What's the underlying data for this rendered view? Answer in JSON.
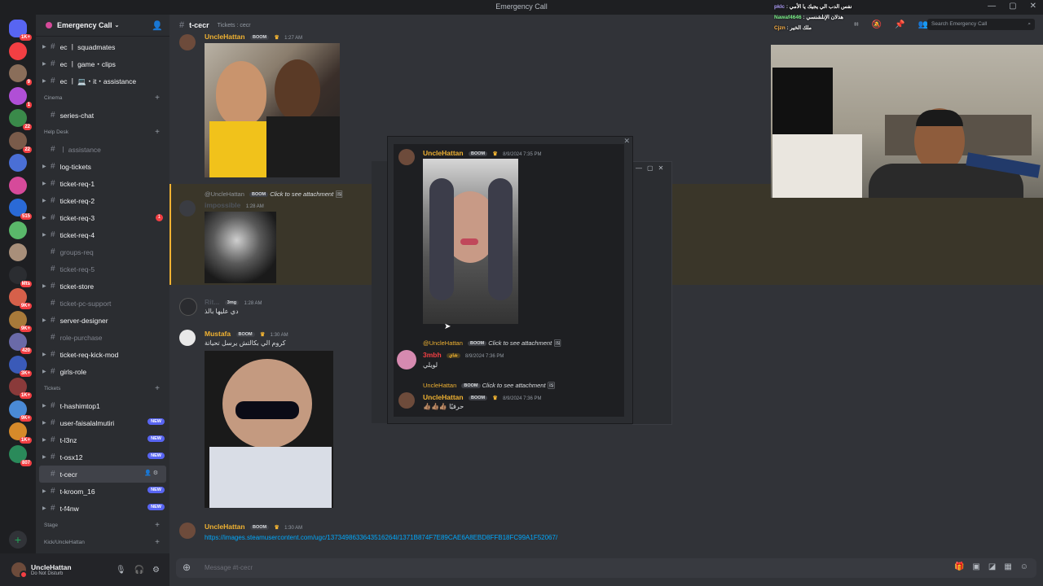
{
  "window": {
    "title": "Emergency Call"
  },
  "server": {
    "name": "Emergency Call"
  },
  "servers": [
    {
      "badge": "1K+",
      "color": "#5865f2"
    },
    {
      "badge": "",
      "color": "#f23f43"
    },
    {
      "badge": "9",
      "color": "#8a6e5a"
    },
    {
      "badge": "1",
      "color": "#b04fd6"
    },
    {
      "badge": "22",
      "color": "#3a8a4a"
    },
    {
      "badge": "22",
      "color": "#7a5b4a"
    },
    {
      "badge": "",
      "color": "#4a6fd6"
    },
    {
      "badge": "",
      "color": "#d64a9a"
    },
    {
      "badge": "515",
      "color": "#2a6ad6"
    },
    {
      "badge": "",
      "color": "#5ab86a"
    },
    {
      "badge": "",
      "color": "#a88f7a"
    },
    {
      "badge": "Mts",
      "color": "#2b2d31"
    },
    {
      "badge": "9K+",
      "color": "#d6604a"
    },
    {
      "badge": "9K+",
      "color": "#a87a3a"
    },
    {
      "badge": "420",
      "color": "#6a6aa8"
    },
    {
      "badge": "3K+",
      "color": "#3a5ab8"
    },
    {
      "badge": "1K+",
      "color": "#8a3a3a"
    },
    {
      "badge": "9K+",
      "color": "#4a8ad6"
    },
    {
      "badge": "1K+",
      "color": "#d68a2a"
    },
    {
      "badge": "807",
      "color": "#2a8a5a"
    }
  ],
  "channels": [
    {
      "kind": "channel",
      "name": "ec ㅣ squadmates",
      "state": "normal",
      "caret": true
    },
    {
      "kind": "channel",
      "name": "ec ㅣ game・clips",
      "state": "normal",
      "caret": true
    },
    {
      "kind": "channel",
      "name": "ec ㅣ 💻・it・assistance",
      "state": "normal",
      "caret": true
    },
    {
      "kind": "category",
      "name": "Cinema"
    },
    {
      "kind": "channel",
      "name": "series-chat",
      "state": "normal",
      "caret": false
    },
    {
      "kind": "category",
      "name": "Help Desk"
    },
    {
      "kind": "channel",
      "name": "ㅣ assistance",
      "state": "muted",
      "caret": false
    },
    {
      "kind": "channel",
      "name": "log-tickets",
      "state": "normal",
      "caret": true
    },
    {
      "kind": "channel",
      "name": "ticket-req-1",
      "state": "normal",
      "caret": true
    },
    {
      "kind": "channel",
      "name": "ticket-req-2",
      "state": "normal",
      "caret": true
    },
    {
      "kind": "channel",
      "name": "ticket-req-3",
      "state": "normal",
      "caret": true,
      "count": "1"
    },
    {
      "kind": "channel",
      "name": "ticket-req-4",
      "state": "normal",
      "caret": true
    },
    {
      "kind": "channel",
      "name": "groups-req",
      "state": "muted",
      "caret": false
    },
    {
      "kind": "channel",
      "name": "ticket-req-5",
      "state": "muted",
      "caret": false
    },
    {
      "kind": "channel",
      "name": "ticket-store",
      "state": "normal",
      "caret": true
    },
    {
      "kind": "channel",
      "name": "ticket-pc-support",
      "state": "muted",
      "caret": false
    },
    {
      "kind": "channel",
      "name": "server-designer",
      "state": "normal",
      "caret": true
    },
    {
      "kind": "channel",
      "name": "role-purchase",
      "state": "muted",
      "caret": false
    },
    {
      "kind": "channel",
      "name": "ticket-req-kick-mod",
      "state": "normal",
      "caret": true
    },
    {
      "kind": "channel",
      "name": "girls-role",
      "state": "normal",
      "caret": true
    },
    {
      "kind": "category",
      "name": "Tickets"
    },
    {
      "kind": "channel",
      "name": "t-hashimtop1",
      "state": "normal",
      "caret": true
    },
    {
      "kind": "channel",
      "name": "user-faisalalmutiri",
      "state": "normal",
      "caret": true,
      "new": "NEW"
    },
    {
      "kind": "channel",
      "name": "t-l3nz",
      "state": "normal",
      "caret": true,
      "new": "NEW"
    },
    {
      "kind": "channel",
      "name": "t-osx12",
      "state": "normal",
      "caret": true,
      "new": "NEW"
    },
    {
      "kind": "channel",
      "name": "t-cecr",
      "state": "active",
      "caret": false
    },
    {
      "kind": "channel",
      "name": "t-kroom_16",
      "state": "normal",
      "caret": true,
      "new": "NEW"
    },
    {
      "kind": "channel",
      "name": "t-f4nw",
      "state": "normal",
      "caret": true,
      "new": "NEW"
    },
    {
      "kind": "category",
      "name": "Stage"
    },
    {
      "kind": "category",
      "name": "Kick/UncleHattan"
    }
  ],
  "user": {
    "name": "UncleHattan",
    "status": "Do Not Disturb"
  },
  "chat_header": {
    "channel": "t-cecr",
    "topic": "Tickets : cecr",
    "search_placeholder": "Search Emergency Call"
  },
  "messages": {
    "m1": {
      "author": "UncleHattan",
      "tag": "BOOM",
      "time": "1:27 AM"
    },
    "m2": {
      "reply_author": "@UncleHattan",
      "reply_tag": "BOOM",
      "reply_cta": "Click to see attachment",
      "author": "impossible",
      "time": "1:28 AM"
    },
    "m3": {
      "author": "Rit...",
      "tag": "3mg",
      "time": "1:28 AM",
      "text": "دي عليها بالذ"
    },
    "m4": {
      "author": "Mustafa",
      "tag": "BOOM",
      "time": "1:30 AM",
      "text": "كروم الي بكالتش يرسل تحياتة"
    },
    "m5": {
      "author": "UncleHattan",
      "tag": "BOOM",
      "time": "1:30 AM",
      "link": "https://images.steamusercontent.com/ugc/1373498633643516264l/1371B874F7E89CAE6A8EBD8FFB18FC99A1F52067/"
    }
  },
  "popup": {
    "p1": {
      "author": "UncleHattan",
      "tag": "BOOM",
      "time": "8/9/2024 7:35 PM"
    },
    "p2": {
      "reply_author": "@UncleHattan",
      "reply_tag": "BOOM",
      "reply_cta": "Click to see attachment",
      "author": "3mbh",
      "tag": "شاي",
      "time": "8/9/2024 7:36 PM",
      "text": "لويلي"
    },
    "p3": {
      "reply_author": "UncleHattan",
      "reply_tag": "BOOM",
      "reply_cta": "Click to see attachment",
      "author": "UncleHattan",
      "tag": "BOOM",
      "time": "8/9/2024 7:36 PM",
      "text": "👍🏽👍🏽👍🏽 حرفيًا"
    }
  },
  "composer": {
    "placeholder": "Message #t-cecr"
  },
  "overlay_chat": [
    {
      "user": "pklc",
      "text": "نفس الدب الي يجيك يا الأمي"
    },
    {
      "user": "Nawaf4646",
      "text": "هذلان الإنلشنسي"
    },
    {
      "user": "Cjzn",
      "text": "ملك الخير"
    }
  ],
  "colors": {
    "accent": "#5865f2",
    "gold": "#f0b232",
    "danger": "#f23f43",
    "link": "#00a8fc",
    "name_red": "#f23f43",
    "name_gold": "#f0b232"
  }
}
